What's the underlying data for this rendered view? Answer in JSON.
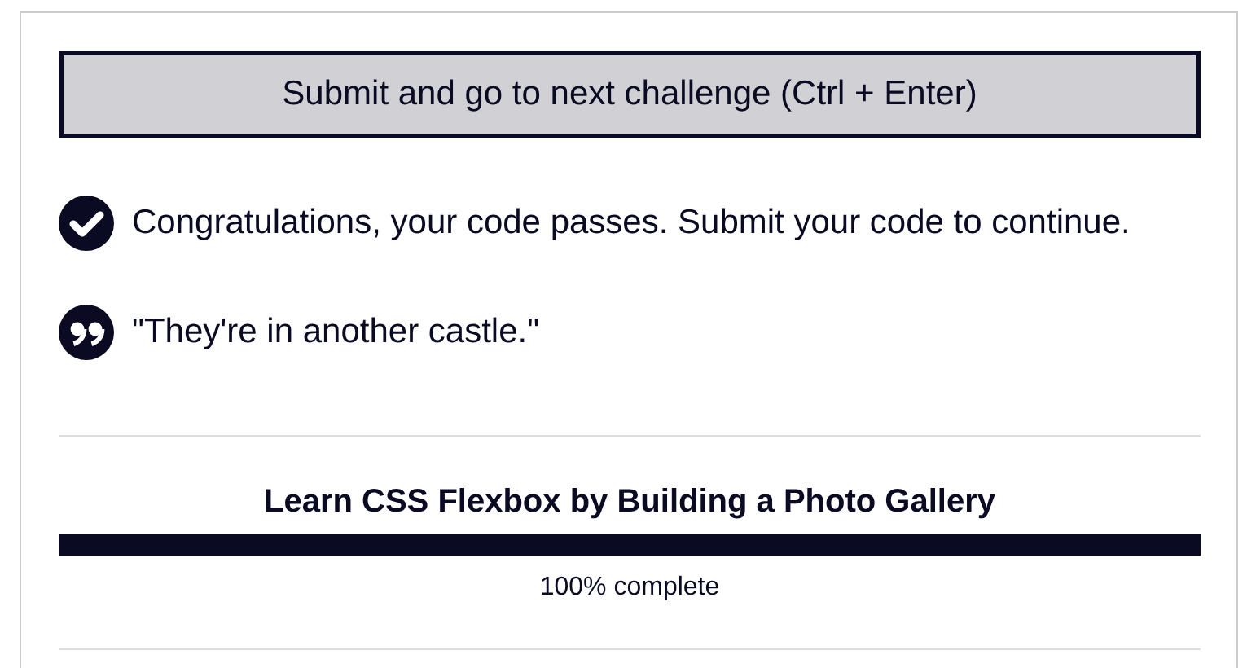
{
  "submit_button": {
    "label": "Submit and go to next challenge (Ctrl + Enter)"
  },
  "messages": [
    {
      "kind": "success",
      "text": "Congratulations, your code passes. Submit your code to continue."
    },
    {
      "kind": "quote",
      "text": "\"They're in another castle.\""
    }
  ],
  "progress": {
    "title": "Learn CSS Flexbox by Building a Photo Gallery",
    "level": 1,
    "reading": "100% complete"
  }
}
